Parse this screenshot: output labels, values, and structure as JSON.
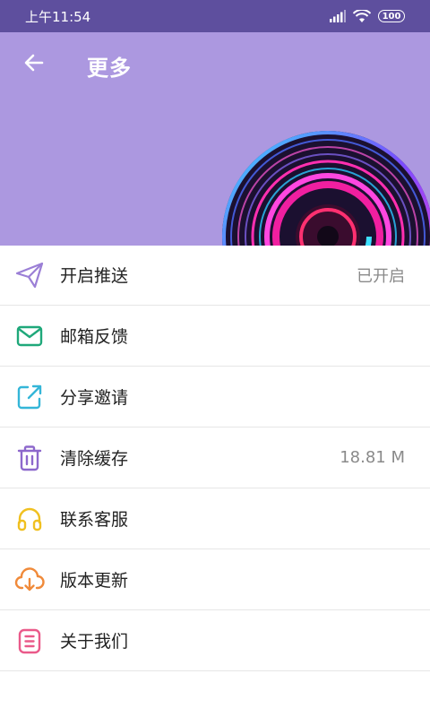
{
  "status_bar": {
    "time": "上午11:54",
    "battery": "100"
  },
  "header": {
    "title": "更多"
  },
  "menu": [
    {
      "label": "开启推送",
      "value": "已开启",
      "icon": "send-icon",
      "color": "#9b7fd6"
    },
    {
      "label": "邮箱反馈",
      "value": "",
      "icon": "mail-icon",
      "color": "#1fa87a"
    },
    {
      "label": "分享邀请",
      "value": "",
      "icon": "share-icon",
      "color": "#34b6d8"
    },
    {
      "label": "清除缓存",
      "value": "18.81 M",
      "icon": "trash-icon",
      "color": "#8d68cc"
    },
    {
      "label": "联系客服",
      "value": "",
      "icon": "headphones-icon",
      "color": "#f0c020"
    },
    {
      "label": "版本更新",
      "value": "",
      "icon": "cloud-download-icon",
      "color": "#f08a3a"
    },
    {
      "label": "关于我们",
      "value": "",
      "icon": "info-card-icon",
      "color": "#ea5a8a"
    }
  ]
}
